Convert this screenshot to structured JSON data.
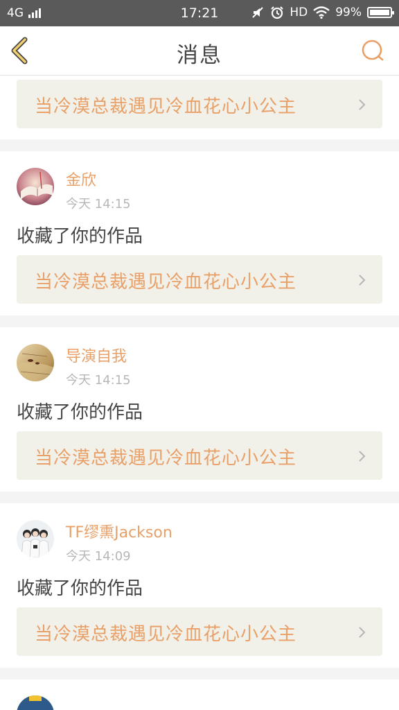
{
  "status_bar": {
    "network": "4G",
    "time": "17:21",
    "hd": "HD",
    "battery": "99%",
    "battery_level": 0.99
  },
  "header": {
    "title": "消息",
    "back_icon": "chevron-left-icon",
    "search_icon": "search-icon"
  },
  "colors": {
    "accent": "#e9a068",
    "back_icon": "#f0d070",
    "text_primary": "#444444",
    "text_secondary": "#b7b7b7",
    "work_box_bg": "#f1f1ea"
  },
  "top_partial": {
    "work_title": "当冷漠总裁遇见冷血花心小公主"
  },
  "messages": [
    {
      "user": "金欣",
      "time": "今天 14:15",
      "action": "收藏了你的作品",
      "work_title": "当冷漠总裁遇见冷血花心小公主"
    },
    {
      "user": "导演自我",
      "time": "今天 14:15",
      "action": "收藏了你的作品",
      "work_title": "当冷漠总裁遇见冷血花心小公主"
    },
    {
      "user": "TF缪熏Jackson",
      "time": "今天 14:09",
      "action": "收藏了你的作品",
      "work_title": "当冷漠总裁遇见冷血花心小公主"
    }
  ]
}
